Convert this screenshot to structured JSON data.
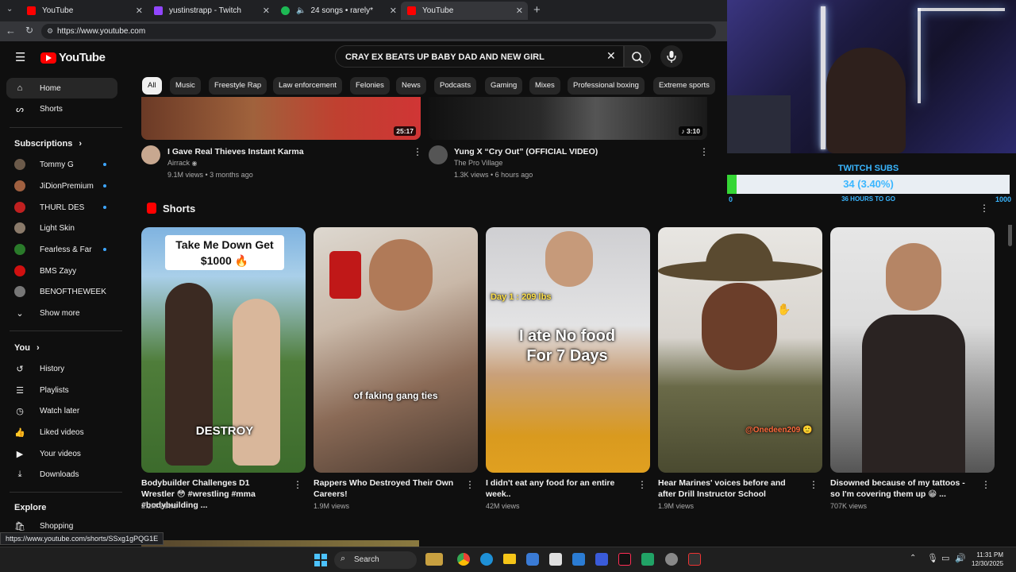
{
  "browser": {
    "tabs": [
      {
        "label": "YouTube",
        "color": "#ff0000"
      },
      {
        "label": "yustinstrapp - Twitch",
        "color": "#9146ff"
      },
      {
        "label": "24 songs • rarely*",
        "color": "#1db954"
      },
      {
        "label": "YouTube",
        "color": "#ff0000"
      }
    ],
    "new_tab": "+",
    "url": "https://www.youtube.com",
    "status_url": "https://www.youtube.com/shorts/SSxg1gPQG1E"
  },
  "youtube": {
    "logo": "YouTube",
    "search_query": "CRAY EX BEATS UP BABY DAD AND NEW GIRL",
    "sidebar": {
      "main": [
        {
          "label": "Home",
          "icon": "home-icon",
          "active": true
        },
        {
          "label": "Shorts",
          "icon": "shorts-icon"
        }
      ],
      "subscriptions_heading": "Subscriptions",
      "subscriptions": [
        {
          "label": "Tommy G",
          "color": "#6b5a4a",
          "dot": true
        },
        {
          "label": "JiDionPremium",
          "color": "#a06040",
          "dot": true
        },
        {
          "label": "THURL DES",
          "color": "#c02020",
          "dot": true
        },
        {
          "label": "Light Skin",
          "color": "#8a7a6a",
          "dot": false
        },
        {
          "label": "Fearless & Far",
          "color": "#2a7a2a",
          "dot": true
        },
        {
          "label": "BMS Zayy",
          "color": "#d01010",
          "dot": false
        },
        {
          "label": "BENOFTHEWEEK",
          "color": "#777777",
          "dot": false
        },
        {
          "label": "Show more",
          "chevron": true
        }
      ],
      "you_heading": "You",
      "you": [
        {
          "label": "History",
          "icon": "history-icon"
        },
        {
          "label": "Playlists",
          "icon": "playlists-icon"
        },
        {
          "label": "Watch later",
          "icon": "watch-later-icon"
        },
        {
          "label": "Liked videos",
          "icon": "like-icon"
        },
        {
          "label": "Your videos",
          "icon": "your-videos-icon"
        },
        {
          "label": "Downloads",
          "icon": "download-icon"
        }
      ],
      "explore_heading": "Explore",
      "explore": [
        {
          "label": "Shopping",
          "icon": "shopping-icon"
        }
      ]
    },
    "chips": [
      "All",
      "Music",
      "Freestyle Rap",
      "Law enforcement",
      "Felonies",
      "News",
      "Podcasts",
      "Gaming",
      "Mixes",
      "Professional boxing",
      "Extreme sports"
    ],
    "videos": [
      {
        "title": "I Gave Real Thieves Instant Karma",
        "channel": "Airrack",
        "verified": "◉",
        "meta": "9.1M views • 3 months ago",
        "duration": "25:17"
      },
      {
        "title": "Yung X “Cry Out” (OFFICIAL VIDEO)",
        "channel": "The Pro Village",
        "meta": "1.3K views • 6 hours ago",
        "duration": "3:10",
        "music": "♪"
      }
    ],
    "shorts_heading": "Shorts",
    "shorts": [
      {
        "title": "Bodybuilder Challenges D1 Wrestler 😳 #wrestling #mma #bodybuilding ...",
        "views": "2.2M views",
        "overlay_top": "Take Me Down Get $1000 🔥",
        "overlay_bottom": "DESTROY"
      },
      {
        "title": "Rappers Who Destroyed Their Own Careers!",
        "views": "1.9M views",
        "overlay_mid": "of faking gang ties"
      },
      {
        "title": "I didn't eat any food for an entire week..",
        "views": "42M views",
        "overlay_top": "Day 1 : 209 lbs",
        "overlay_mid": "I ate No food For 7 Days"
      },
      {
        "title": "Hear Marines' voices before and after Drill Instructor School",
        "views": "1.9M views",
        "overlay_bottom": "@Onedeen209 🙂"
      },
      {
        "title": "Disowned because of my tattoos - so I'm covering them up 😁 ...",
        "views": "707K views"
      }
    ]
  },
  "stream_overlay": {
    "title": "TWITCH SUBS",
    "progress_text": "34 (3.40%)",
    "progress": 0.034,
    "start": "0",
    "end": "1000",
    "time_left": "36 HOURS TO GO"
  },
  "taskbar": {
    "search": "Search",
    "time": "11:31 PM",
    "date": "12/30/2025"
  }
}
